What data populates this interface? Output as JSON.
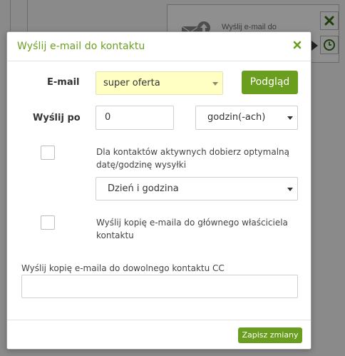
{
  "background": {
    "node_label": "Wyślij e-mail do",
    "node_icon": "send-email-icon",
    "delete_icon": "close-x-icon",
    "clock_icon": "clock-icon"
  },
  "dialog": {
    "title": "Wyślij e-mail do kontaktu",
    "close_icon": "close-icon",
    "email": {
      "label": "E-mail",
      "selected": "super oferta",
      "preview_button": "Podgląd"
    },
    "send_after": {
      "label": "Wyślij po",
      "value": "0",
      "unit_selected": "godzin(-ach)"
    },
    "optimal": {
      "checked": false,
      "text": "Dla kontaktów aktywnych dobierz optymalną datę/godzinę wysyłki",
      "select_value": "Dzień i godzina"
    },
    "copy_owner": {
      "checked": false,
      "text": "Wyślij kopię e-maila do głównego właściciela kontaktu"
    },
    "cc": {
      "label": "Wyślij kopię e-maila do dowolnego kontaktu CC",
      "value": ""
    },
    "save_button": "Zapisz zmiany"
  },
  "colors": {
    "accent_green": "#6a9e1f",
    "highlight_yellow": "#ffffc4",
    "overlay_gray": "#8a8a8a"
  }
}
